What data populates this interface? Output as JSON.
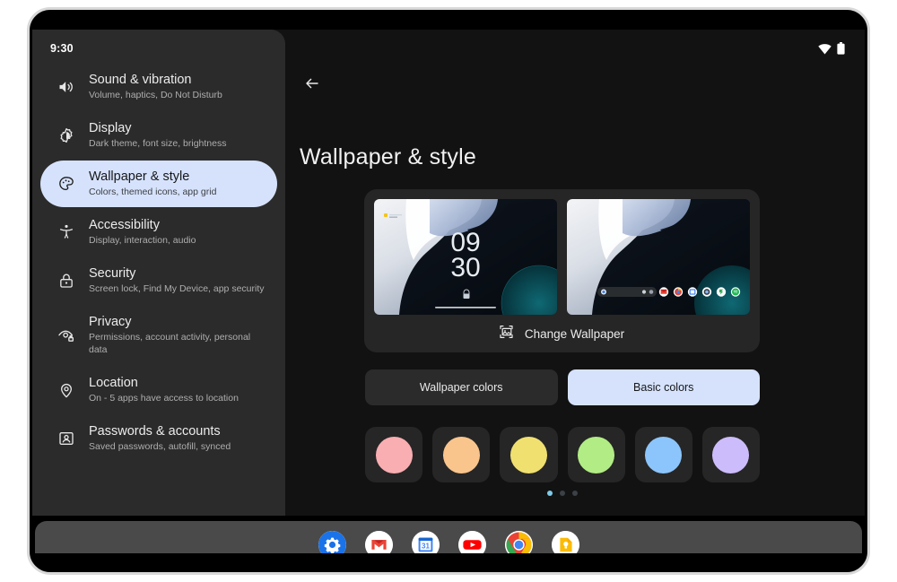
{
  "status_bar": {
    "time": "9:30",
    "icons": [
      "wifi-icon",
      "battery-icon"
    ]
  },
  "sidebar": {
    "items": [
      {
        "icon": "sound-icon",
        "title": "Sound & vibration",
        "subtitle": "Volume, haptics, Do Not Disturb",
        "selected": false
      },
      {
        "icon": "brightness-icon",
        "title": "Display",
        "subtitle": "Dark theme, font size, brightness",
        "selected": false
      },
      {
        "icon": "palette-icon",
        "title": "Wallpaper & style",
        "subtitle": "Colors, themed icons, app grid",
        "selected": true
      },
      {
        "icon": "accessibility-icon",
        "title": "Accessibility",
        "subtitle": "Display, interaction, audio",
        "selected": false
      },
      {
        "icon": "lock-icon",
        "title": "Security",
        "subtitle": "Screen lock, Find My Device, app security",
        "selected": false
      },
      {
        "icon": "privacy-eye-icon",
        "title": "Privacy",
        "subtitle": "Permissions, account activity, personal data",
        "selected": false
      },
      {
        "icon": "location-pin-icon",
        "title": "Location",
        "subtitle": "On - 5 apps have access to location",
        "selected": false
      },
      {
        "icon": "account-card-icon",
        "title": "Passwords & accounts",
        "subtitle": "Saved passwords, autofill, synced",
        "selected": false
      }
    ]
  },
  "main": {
    "back_icon": "back-arrow-icon",
    "title": "Wallpaper & style",
    "preview": {
      "lock_screen": {
        "clock_hours": "09",
        "clock_minutes": "30"
      },
      "home_screen": {
        "label": "home-screen-preview"
      },
      "change_wallpaper": {
        "icon": "image-frame-icon",
        "label": "Change Wallpaper"
      }
    },
    "tabs": [
      {
        "label": "Wallpaper colors",
        "selected": false
      },
      {
        "label": "Basic colors",
        "selected": true
      }
    ],
    "swatches": [
      {
        "name": "pink",
        "color": "#f9aeb2"
      },
      {
        "name": "orange",
        "color": "#f9c58c"
      },
      {
        "name": "yellow",
        "color": "#f0e070"
      },
      {
        "name": "green",
        "color": "#b2ec85"
      },
      {
        "name": "blue",
        "color": "#8cc5fb"
      },
      {
        "name": "purple",
        "color": "#cdbcfb"
      }
    ],
    "page_dots": {
      "count": 3,
      "active_index": 0
    }
  },
  "dock": {
    "apps": [
      {
        "name": "settings-app-icon"
      },
      {
        "name": "gmail-app-icon"
      },
      {
        "name": "calendar-app-icon",
        "day": "31"
      },
      {
        "name": "youtube-app-icon"
      },
      {
        "name": "chrome-app-icon"
      },
      {
        "name": "keep-app-icon"
      }
    ]
  },
  "theme": {
    "accent": "#d6e2fb",
    "surface": "#2b2b2b",
    "background": "#121212",
    "dock_background": "#4a4a4a"
  }
}
